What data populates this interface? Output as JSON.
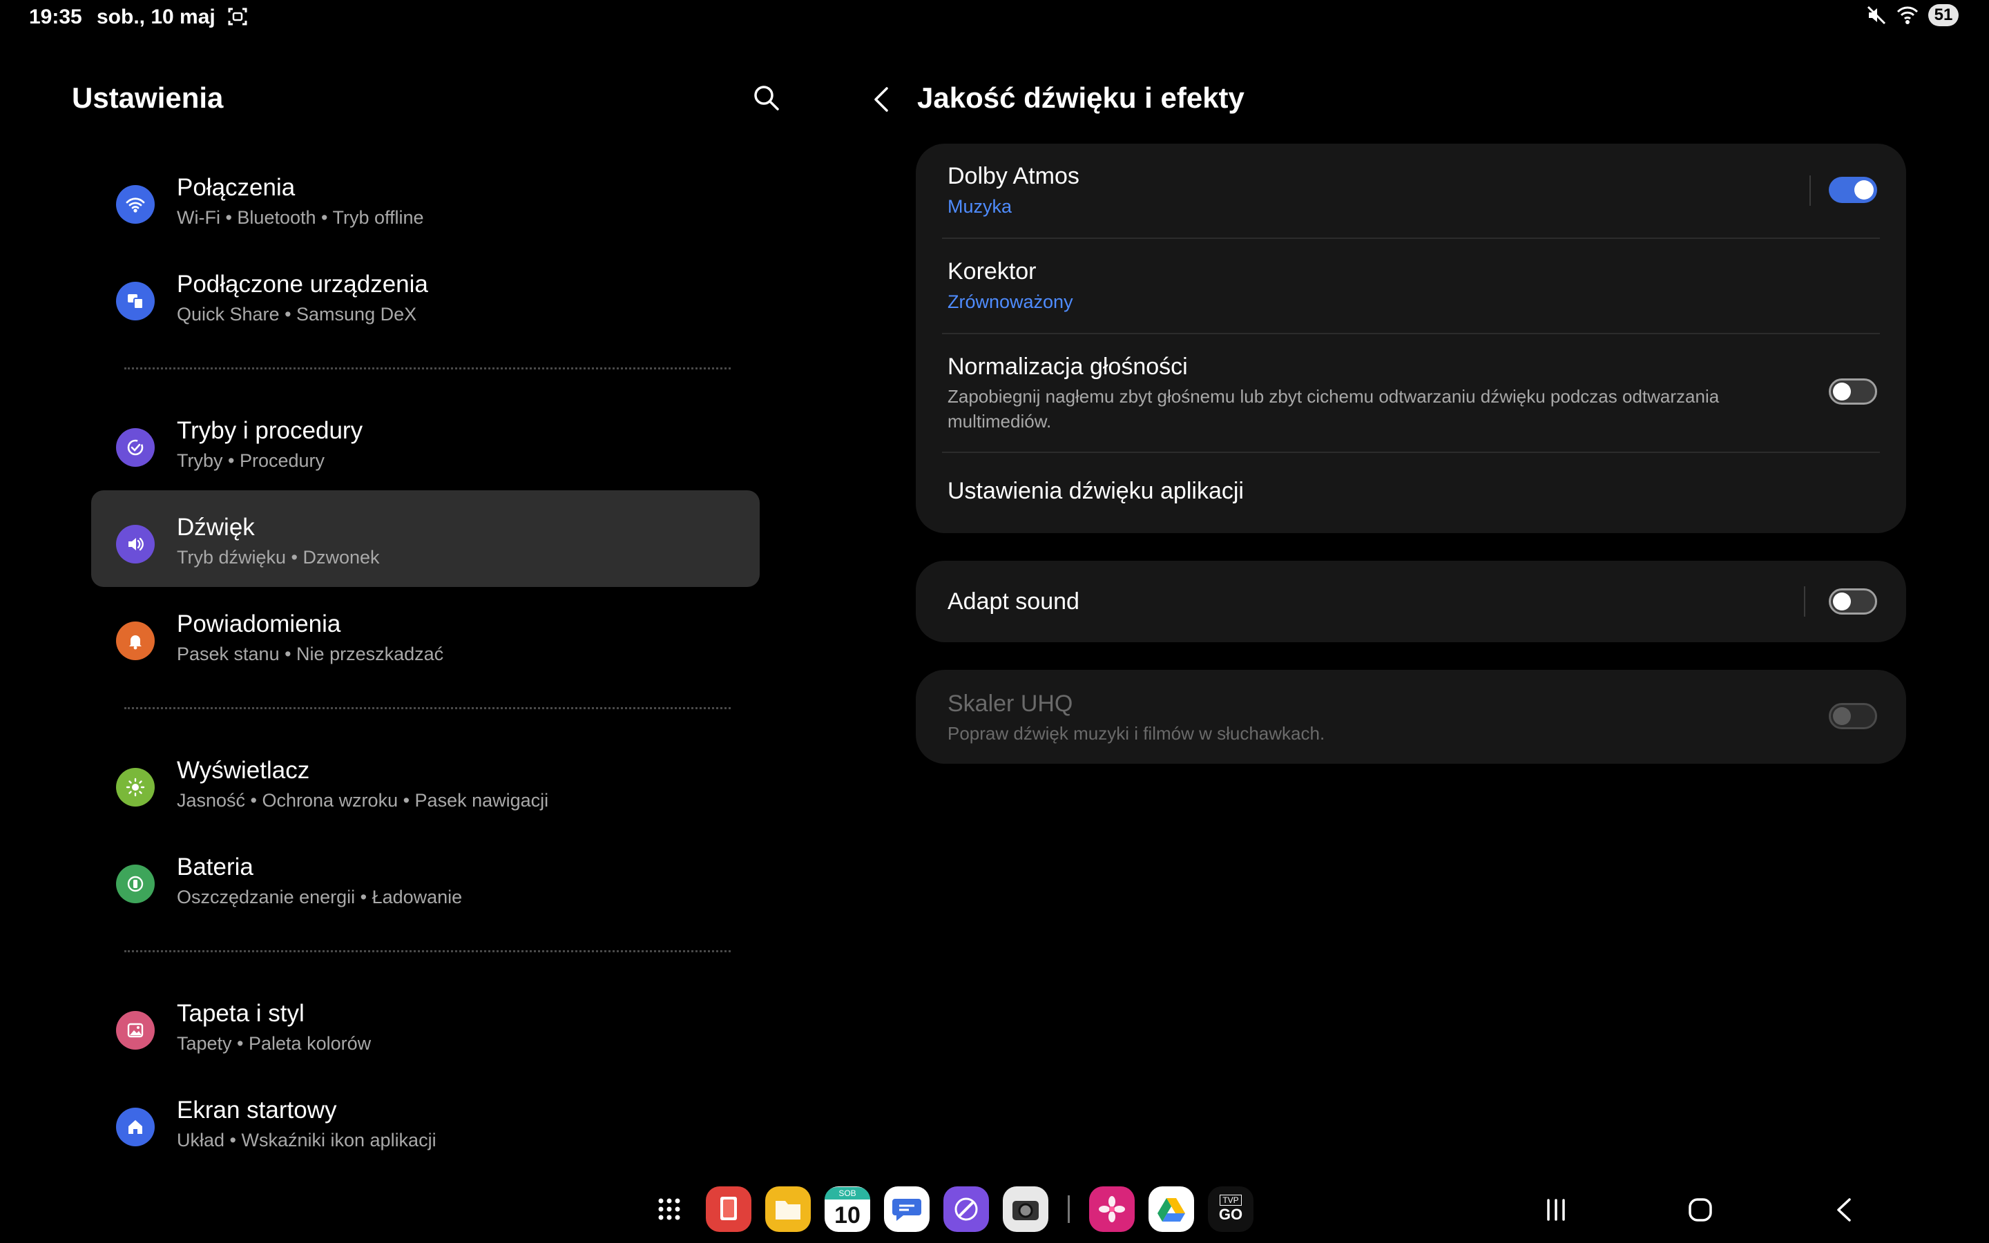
{
  "status_bar": {
    "time": "19:35",
    "date": "sob., 10 maj",
    "battery": "51"
  },
  "left_panel": {
    "title": "Ustawienia",
    "items": [
      {
        "title": "Połączenia",
        "subtitle": "Wi-Fi  •  Bluetooth  •  Tryb offline",
        "icon": "wifi-icon",
        "color": "#3d68e6"
      },
      {
        "title": "Podłączone urządzenia",
        "subtitle": "Quick Share  •  Samsung DeX",
        "icon": "devices-icon",
        "color": "#3d68e6"
      },
      {
        "title": "Tryby i procedury",
        "subtitle": "Tryby  •  Procedury",
        "icon": "modes-icon",
        "color": "#6b4fd8"
      },
      {
        "title": "Dźwięk",
        "subtitle": "Tryb dźwięku  •  Dzwonek",
        "icon": "speaker-icon",
        "color": "#6b4fd8",
        "active": true
      },
      {
        "title": "Powiadomienia",
        "subtitle": "Pasek stanu  •  Nie przeszkadzać",
        "icon": "bell-icon",
        "color": "#e26a2c"
      },
      {
        "title": "Wyświetlacz",
        "subtitle": "Jasność  •  Ochrona wzroku  •  Pasek nawigacji",
        "icon": "brightness-icon",
        "color": "#7ab83a"
      },
      {
        "title": "Bateria",
        "subtitle": "Oszczędzanie energii  •  Ładowanie",
        "icon": "battery-icon",
        "color": "#3ea55a"
      },
      {
        "title": "Tapeta i styl",
        "subtitle": "Tapety  •  Paleta kolorów",
        "icon": "wallpaper-icon",
        "color": "#d6577a"
      },
      {
        "title": "Ekran startowy",
        "subtitle": "Układ  •  Wskaźniki ikon aplikacji",
        "icon": "home-icon",
        "color": "#3d68e6"
      }
    ]
  },
  "right_panel": {
    "title": "Jakość dźwięku i efekty",
    "card1": {
      "dolby": {
        "title": "Dolby Atmos",
        "subtitle": "Muzyka",
        "toggle": "on"
      },
      "equalizer": {
        "title": "Korektor",
        "subtitle": "Zrównoważony"
      },
      "normalization": {
        "title": "Normalizacja głośności",
        "description": "Zapobiegnij nagłemu zbyt głośnemu lub zbyt cichemu odtwarzaniu dźwięku podczas odtwarzania multimediów.",
        "toggle": "off"
      },
      "app_sound": {
        "title": "Ustawienia dźwięku aplikacji"
      }
    },
    "adapt_sound": {
      "title": "Adapt sound",
      "toggle": "off"
    },
    "uhq": {
      "title": "Skaler UHQ",
      "description": "Popraw dźwięk muzyki i filmów w słuchawkach.",
      "toggle": "disabled"
    }
  },
  "dock": {
    "calendar_day": "10",
    "calendar_label": "SOB",
    "tvp_label": "GO",
    "tvp_top": "TVP"
  },
  "colors": {
    "accent": "#3e6ee0",
    "link_blue": "#4f8cff",
    "card_bg": "#171717",
    "active_row": "#2f2f2f"
  }
}
